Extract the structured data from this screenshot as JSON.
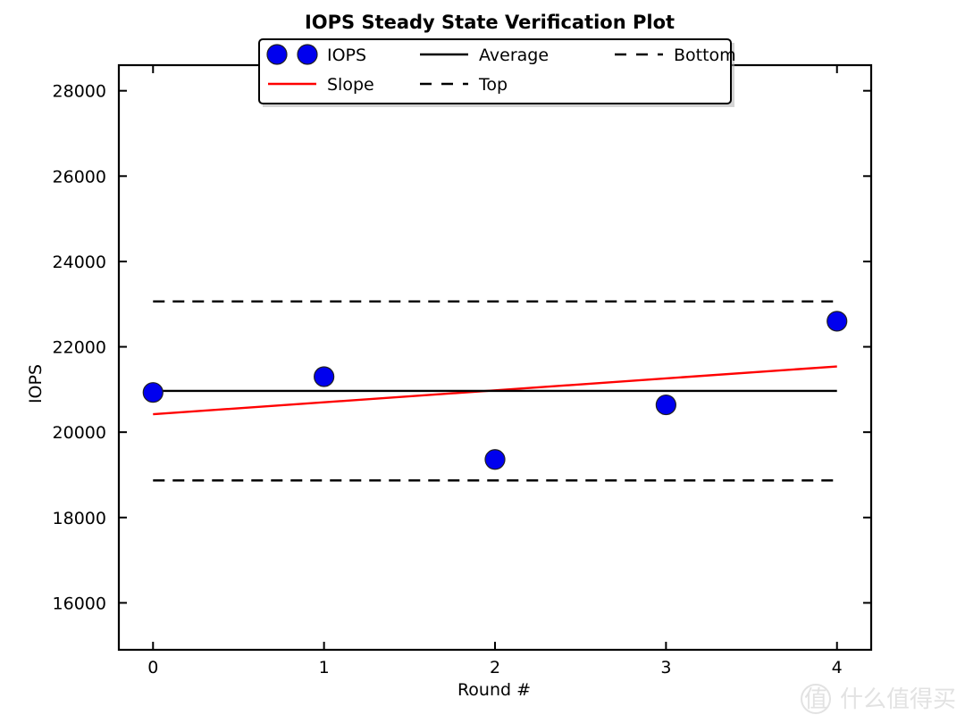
{
  "chart_data": {
    "type": "scatter",
    "title": "IOPS Steady State Verification Plot",
    "xlabel": "Round #",
    "ylabel": "IOPS",
    "xlim": [
      -0.2,
      4.2
    ],
    "ylim": [
      14900,
      28600
    ],
    "xticks": [
      "0",
      "1",
      "2",
      "3",
      "4"
    ],
    "xtick_values": [
      0,
      1,
      2,
      3,
      4
    ],
    "yticks": [
      "16000",
      "18000",
      "20000",
      "22000",
      "24000",
      "26000",
      "28000"
    ],
    "ytick_values": [
      16000,
      18000,
      20000,
      22000,
      24000,
      26000,
      28000
    ],
    "grid": false,
    "legend_position": "upper center",
    "series": [
      {
        "name": "IOPS",
        "type": "scatter",
        "color": "#0000ee",
        "marker": "circle",
        "x": [
          0,
          1,
          2,
          3,
          4
        ],
        "values": [
          20930,
          21300,
          19360,
          20640,
          22600
        ]
      },
      {
        "name": "Slope",
        "type": "line",
        "color": "#ff0000",
        "style": "solid",
        "x": [
          0,
          4
        ],
        "values": [
          20420,
          21540
        ]
      },
      {
        "name": "Average",
        "type": "line",
        "color": "#000000",
        "style": "solid",
        "x": [
          0,
          4
        ],
        "values": [
          20966,
          20966
        ]
      },
      {
        "name": "Top",
        "type": "line",
        "color": "#000000",
        "style": "dashed",
        "x": [
          0,
          4
        ],
        "values": [
          23063,
          23063
        ]
      },
      {
        "name": "Bottom",
        "type": "line",
        "color": "#000000",
        "style": "dashed",
        "x": [
          0,
          4
        ],
        "values": [
          18869,
          18869
        ]
      }
    ],
    "legend_entries": [
      {
        "label": "IOPS",
        "marker": "double-circle",
        "color": "#0000ee"
      },
      {
        "label": "Average",
        "marker": "solid-line",
        "color": "#000000"
      },
      {
        "label": "Bottom",
        "marker": "dashed-line",
        "color": "#000000"
      },
      {
        "label": "Slope",
        "marker": "solid-line",
        "color": "#ff0000"
      },
      {
        "label": "Top",
        "marker": "dashed-line",
        "color": "#000000"
      }
    ]
  },
  "watermark": {
    "logo_glyph": "值",
    "text": "什么值得买"
  }
}
